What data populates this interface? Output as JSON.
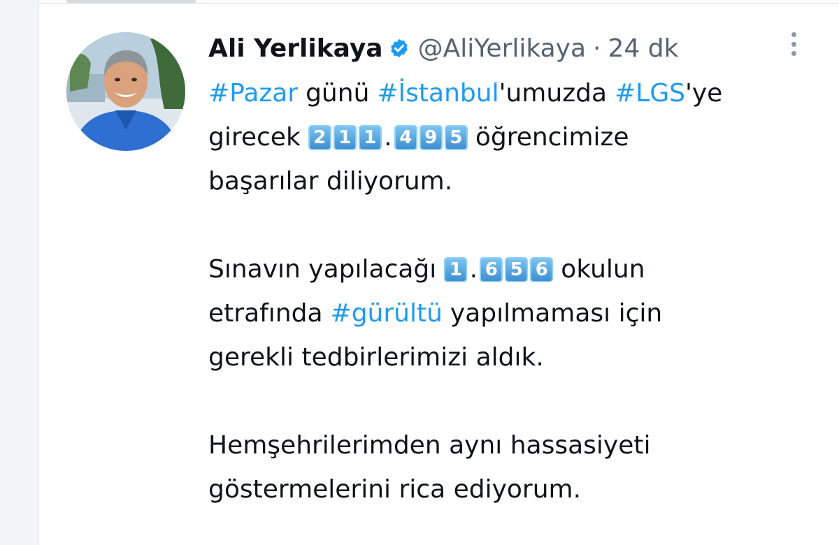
{
  "tweet": {
    "display_name": "Ali Yerlikaya",
    "handle": "@AliYerlikaya",
    "separator": "·",
    "time": "24 dk",
    "lines": {
      "l1": {
        "h1": "#Pazar",
        "t1": "günü",
        "h2": "#İstanbul",
        "t2": "'umuzda",
        "h3": "#LGS",
        "t3": "'ye"
      },
      "l2": {
        "t1": "girecek",
        "digits": [
          "2",
          "1",
          "1",
          ".",
          "4",
          "9",
          "5"
        ],
        "t2": "öğrencimize"
      },
      "l3": {
        "t1": "başarılar diliyorum."
      },
      "l4": {
        "t1": "Sınavın yapılacağı",
        "digits": [
          "1",
          ".",
          "6",
          "5",
          "6"
        ],
        "t2": "okulun"
      },
      "l5": {
        "t1": "etrafında",
        "h1": "#gürültü",
        "t2": "yapılmaması için"
      },
      "l6": {
        "t1": "gerekli tedbirlerimizi aldık."
      },
      "l7": {
        "t1": "Hemşehrilerimden aynı hassasiyeti"
      },
      "l8": {
        "t1": "göstermelerini rica ediyorum."
      }
    }
  },
  "colors": {
    "hashtag": "#1d9bf0",
    "verified_badge": "#1d9bf0",
    "secondary_text": "#536471",
    "primary_text": "#0f1419"
  },
  "icons": {
    "verified": "verified-badge-icon",
    "more": "more-options-icon"
  }
}
